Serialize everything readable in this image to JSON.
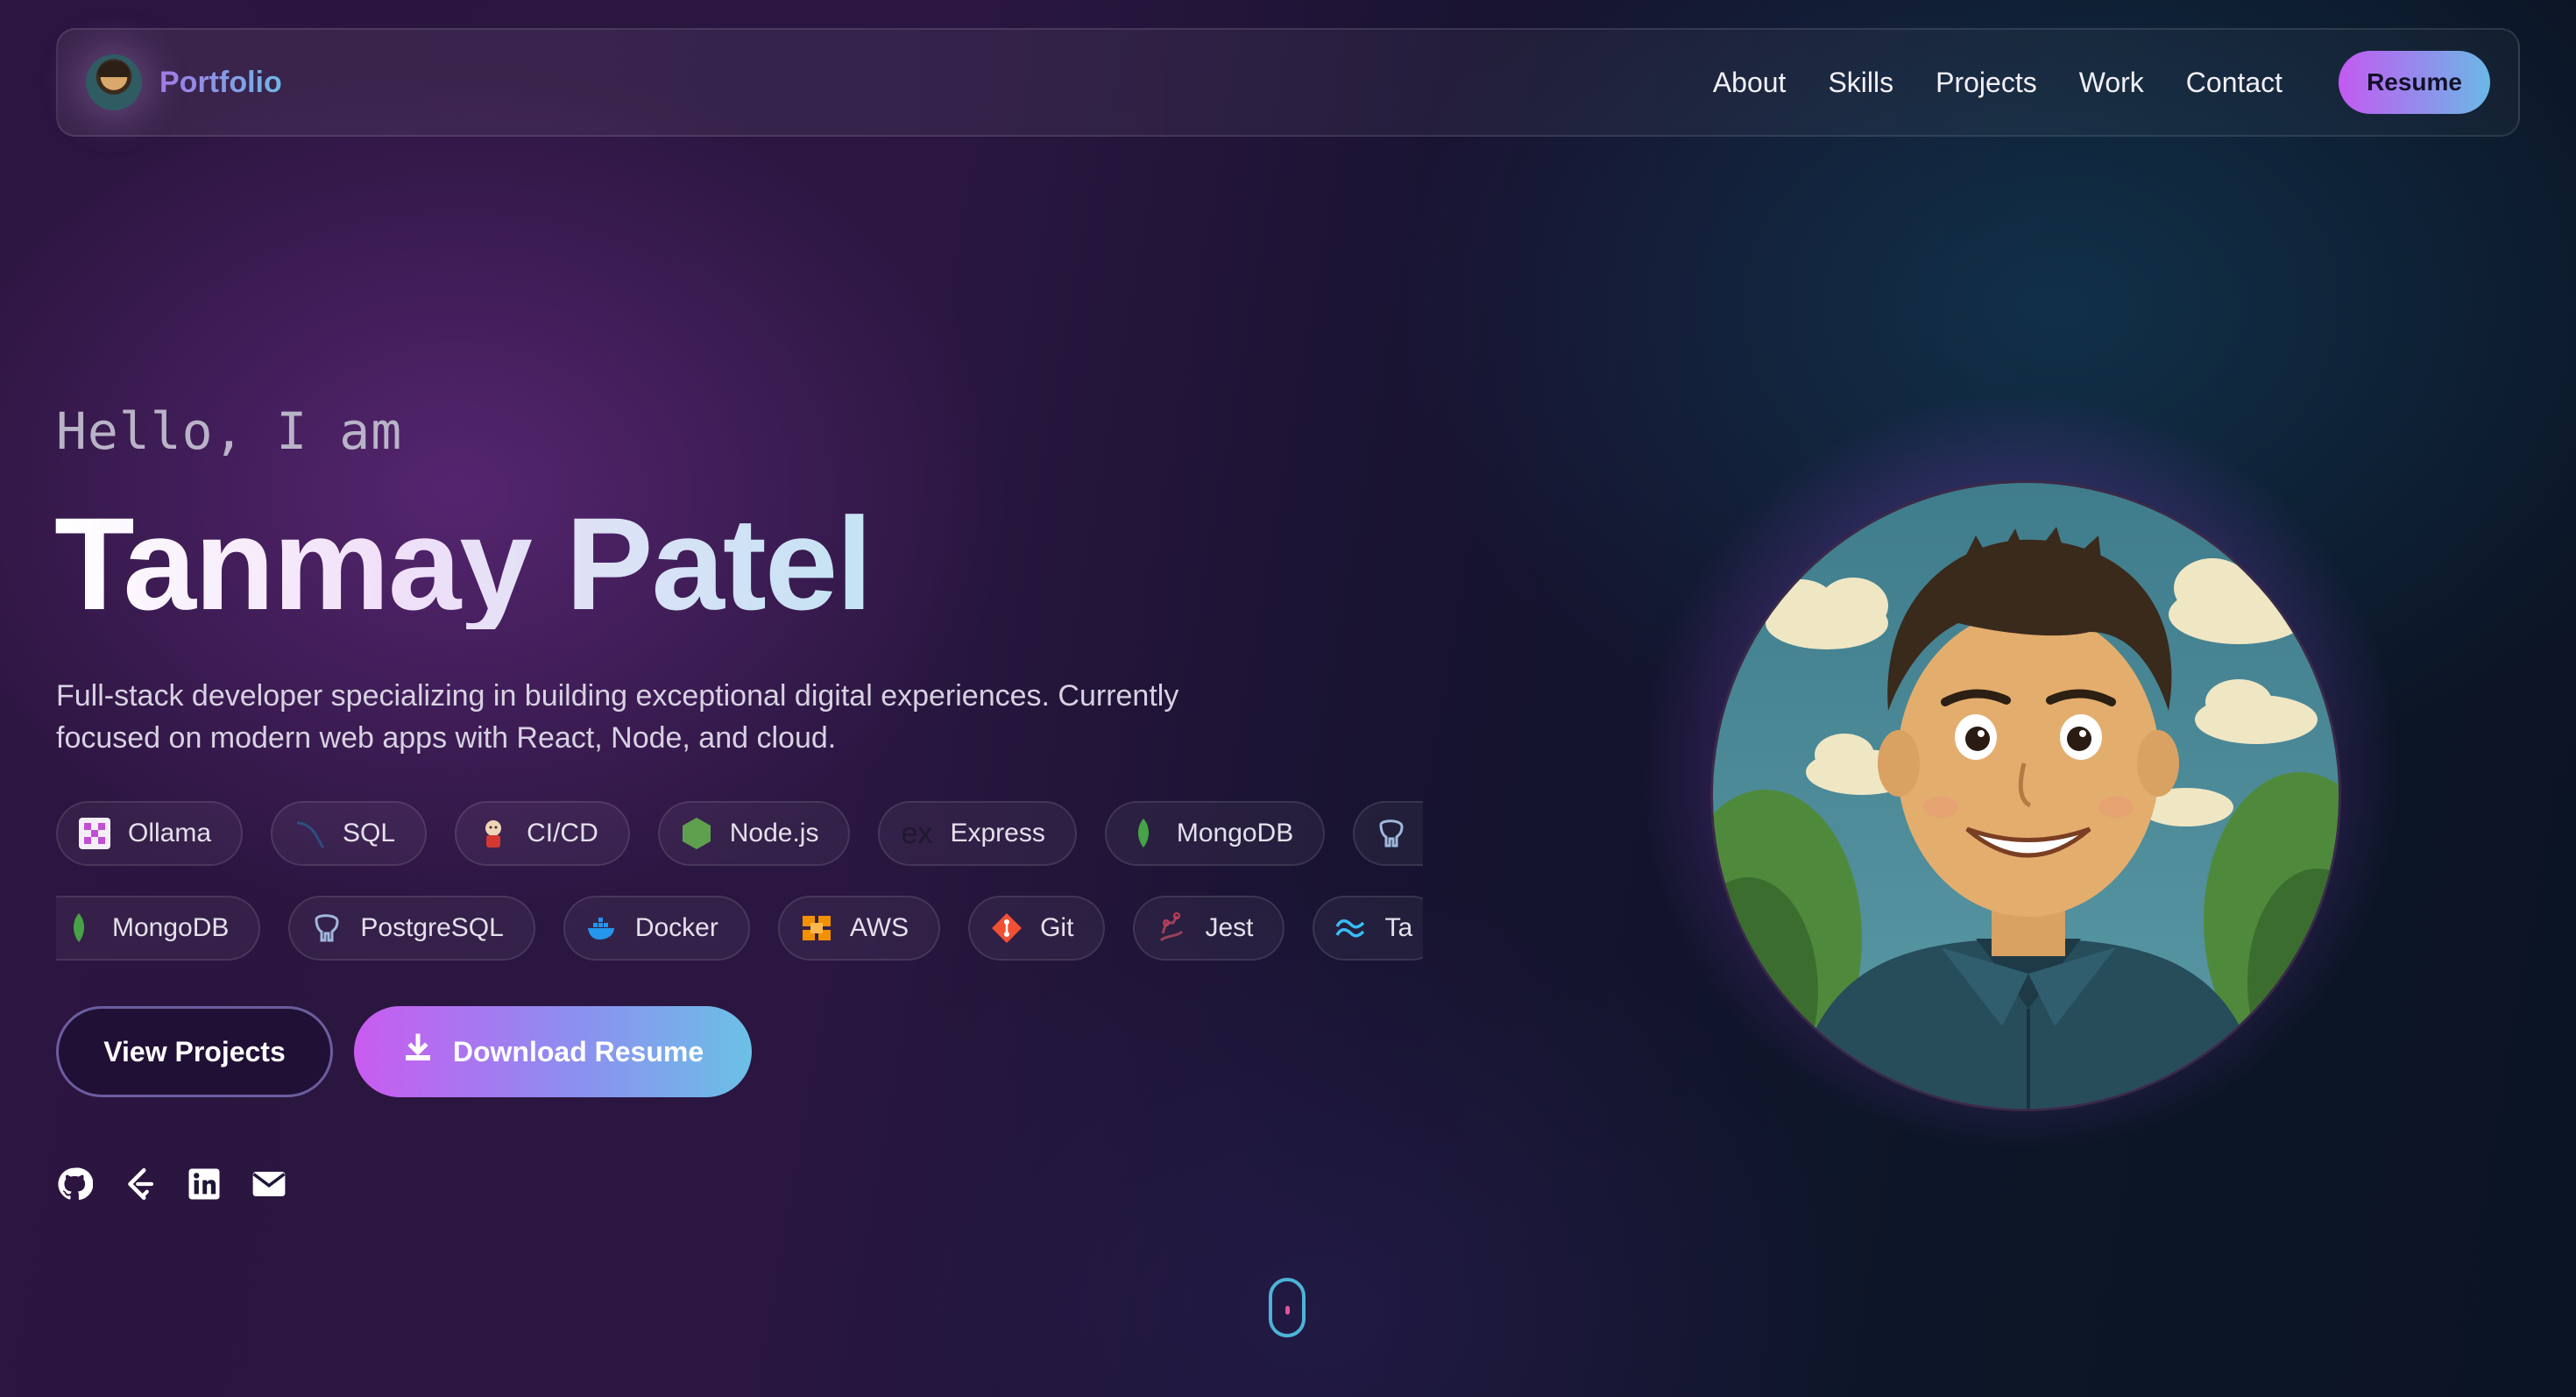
{
  "nav": {
    "brand": "Portfolio",
    "links": [
      "About",
      "Skills",
      "Projects",
      "Work",
      "Contact"
    ],
    "resume_label": "Resume"
  },
  "hero": {
    "greeting": "Hello, I am",
    "name": "Tanmay Patel",
    "description": "Full-stack developer specializing in building exceptional digital experiences. Currently focused on modern web apps with React, Node, and cloud."
  },
  "skills": {
    "row1": [
      "Ollama",
      "SQL",
      "CI/CD",
      "Node.js",
      "Express",
      "MongoDB",
      ""
    ],
    "row2": [
      "MongoDB",
      "PostgreSQL",
      "Docker",
      "AWS",
      "Git",
      "Jest",
      "Ta"
    ]
  },
  "buttons": {
    "view_projects": "View Projects",
    "download_resume": "Download Resume"
  },
  "social": [
    "github-icon",
    "leetcode-icon",
    "linkedin-icon",
    "email-icon"
  ],
  "colors": {
    "accent_purple": "#c95bf0",
    "accent_cyan": "#6bc0e6",
    "background_dark": "#171330"
  }
}
